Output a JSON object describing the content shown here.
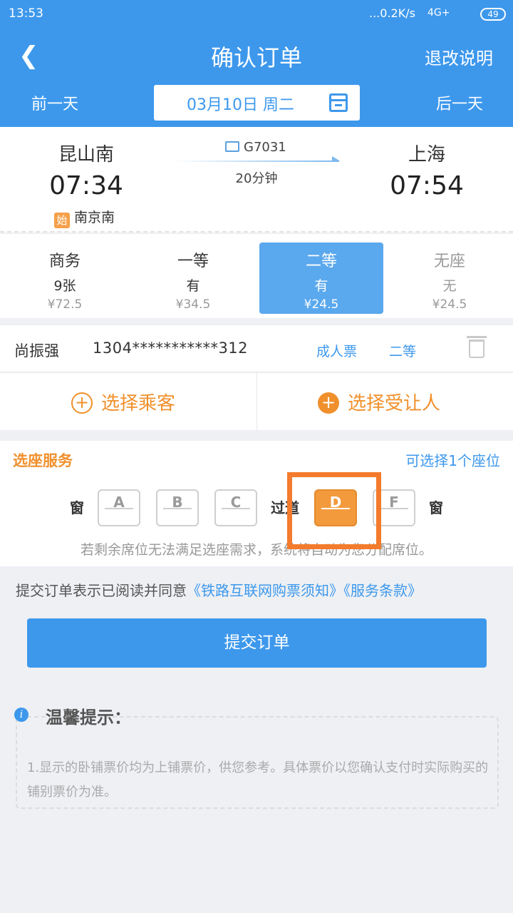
{
  "status_bar": {
    "time": "13:53",
    "network": "...0.2K/s",
    "signal": "4G+",
    "battery": "49"
  },
  "header": {
    "title": "确认订单",
    "refund_link": "退改说明",
    "prev_day": "前一天",
    "next_day": "后一天",
    "date": "03月10日 周二"
  },
  "train": {
    "from_station": "昆山南",
    "from_time": "07:34",
    "origin_badge": "始",
    "origin_station": "南京南",
    "train_no": "G7031",
    "duration": "20分钟",
    "to_station": "上海",
    "to_time": "07:54"
  },
  "seat_classes": [
    {
      "name": "商务",
      "count": "9张",
      "price": "¥72.5"
    },
    {
      "name": "一等",
      "count": "有",
      "price": "¥34.5"
    },
    {
      "name": "二等",
      "count": "有",
      "price": "¥24.5"
    },
    {
      "name": "无座",
      "count": "无",
      "price": "¥24.5"
    }
  ],
  "passenger": {
    "name": "尚振强",
    "id": "1304***********312",
    "ticket_type": "成人票",
    "seat_class": "二等"
  },
  "choose": {
    "passenger": "选择乘客",
    "beneficiary": "选择受让人"
  },
  "seat_service": {
    "title": "选座服务",
    "available": "可选择1个座位",
    "window_left": "窗",
    "aisle": "过道",
    "window_right": "窗",
    "seats": [
      "A",
      "B",
      "C",
      "D",
      "F"
    ],
    "selected": "D",
    "note": "若剩余席位无法满足选座需求，系统将自动为您分配席位。"
  },
  "agreement": {
    "prefix": "提交订单表示已阅读并同意",
    "link1": "《铁路互联网购票须知》",
    "link2": "《服务条款》"
  },
  "submit": "提交订单",
  "tips": {
    "title": "温馨提示：",
    "text": "1.显示的卧铺票价均为上铺票价，供您参考。具体票价以您确认支付时实际购买的铺别票价为准。"
  }
}
